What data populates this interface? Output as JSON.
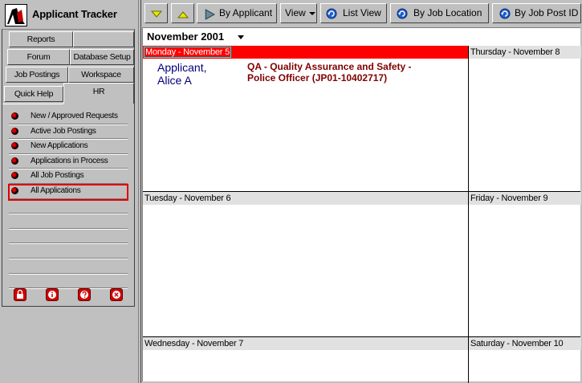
{
  "app": {
    "title": "Applicant Tracker"
  },
  "tabs": {
    "row1": [
      "Reports",
      ""
    ],
    "row2": [
      "Forum",
      "Database Setup"
    ],
    "row3": [
      "Job Postings",
      "Workspace"
    ],
    "row4": [
      "Quick Help",
      "HR"
    ]
  },
  "nav": {
    "items": [
      {
        "label": "New / Approved Requests"
      },
      {
        "label": "Active Job Postings"
      },
      {
        "label": "New Applications"
      },
      {
        "label": "Applications in Process"
      },
      {
        "label": "All Job Postings"
      },
      {
        "label": "All Applications",
        "selected": true
      }
    ]
  },
  "bottom_icons": [
    "lock-icon",
    "info-icon",
    "help-icon",
    "close-icon"
  ],
  "toolbar": {
    "down_arrow": "arrow-down-icon",
    "up_arrow": "arrow-up-icon",
    "by_applicant": "By Applicant",
    "view": "View",
    "list_view": "List View",
    "by_job_location": "By Job Location",
    "by_job_post_id": "By Job Post ID"
  },
  "calendar": {
    "month": "November 2001",
    "days": {
      "monday": "Monday - November 5",
      "tuesday": "Tuesday - November 6",
      "wednesday": "Wednesday - November 7",
      "thursday": "Thursday - November 8",
      "friday": "Friday - November 9",
      "saturday": "Saturday - November 10"
    },
    "appointments": [
      {
        "name_line1": "Applicant,",
        "name_line2": "Alice A",
        "job_line1": "QA - Quality Assurance and Safety -",
        "job_line2": "Police Officer (JP01-10402717)"
      }
    ]
  },
  "colors": {
    "active_day": "#ff0000",
    "applicant_name": "#00007a",
    "job_title": "#800000",
    "selected_outline": "#e00000"
  }
}
